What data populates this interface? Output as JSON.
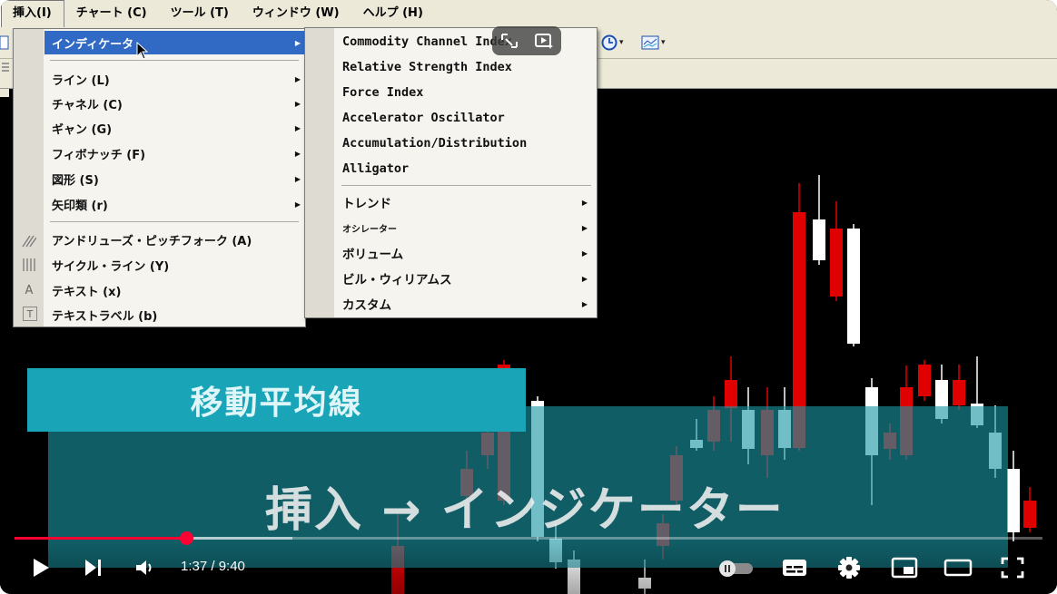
{
  "menubar": {
    "items": [
      {
        "label": "挿入(I)",
        "active": true
      },
      {
        "label": "チャート (C)"
      },
      {
        "label": "ツール (T)"
      },
      {
        "label": "ウィンドウ (W)"
      },
      {
        "label": "ヘルプ (H)"
      }
    ]
  },
  "insert_menu": {
    "items": [
      {
        "label": "インディケータ",
        "has_submenu": true,
        "selected": true
      },
      {
        "label": "ライン (L)",
        "has_submenu": true
      },
      {
        "label": "チャネル (C)",
        "has_submenu": true
      },
      {
        "label": "ギャン (G)",
        "has_submenu": true
      },
      {
        "label": "フィボナッチ (F)",
        "has_submenu": true
      },
      {
        "label": "図形 (S)",
        "has_submenu": true
      },
      {
        "label": "矢印類 (r)",
        "has_submenu": true
      },
      {
        "label": "アンドリューズ・ピッチフォーク (A)",
        "icon": "pitchfork-icon"
      },
      {
        "label": "サイクル・ライン (Y)",
        "icon": "cycle-lines-icon"
      },
      {
        "label": "テキスト (x)",
        "icon": "text-icon",
        "icon_glyph": "A"
      },
      {
        "label": "テキストラベル (b)",
        "icon": "text-label-icon",
        "icon_glyph": "T"
      }
    ]
  },
  "indicator_submenu": {
    "items": [
      {
        "label": "Commodity Channel Index"
      },
      {
        "label": "Relative Strength Index"
      },
      {
        "label": "Force Index"
      },
      {
        "label": "Accelerator Oscillator"
      },
      {
        "label": "Accumulation/Distribution"
      },
      {
        "label": "Alligator"
      },
      {
        "label": "トレンド",
        "has_submenu": true
      },
      {
        "label": "オシレーター",
        "has_submenu": true
      },
      {
        "label": "ボリューム",
        "has_submenu": true
      },
      {
        "label": "ビル・ウィリアムス",
        "has_submenu": true
      },
      {
        "label": "カスタム",
        "has_submenu": true
      }
    ]
  },
  "overlay": {
    "title": "移動平均線",
    "caption": "挿入 → インジケーター"
  },
  "player": {
    "time": "1:37 / 9:40",
    "progress_fraction": 0.1672,
    "buffer_fraction": 0.27,
    "accent_color": "#ff0033",
    "controls": [
      "play-icon",
      "next-icon",
      "volume-icon",
      "autoplay-toggle-icon",
      "subtitles-icon",
      "settings-icon",
      "miniplayer-icon",
      "theater-icon",
      "fullscreen-icon"
    ]
  },
  "colors": {
    "up_candle": "#ffffff",
    "down_candle": "#e00000",
    "teal_banner": "#1aa4b7",
    "menu_highlight": "#316ac5"
  }
}
